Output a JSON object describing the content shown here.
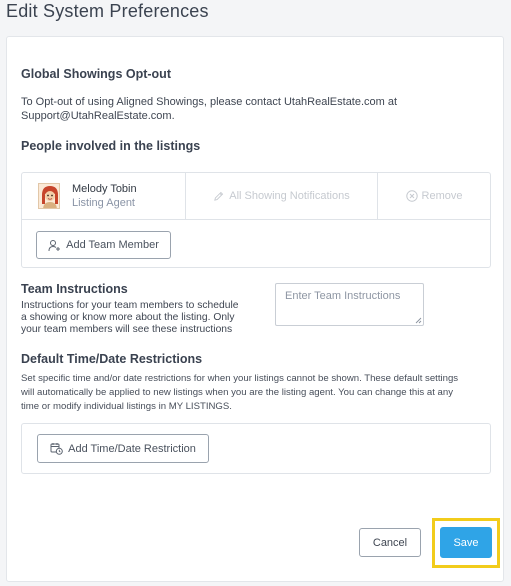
{
  "page": {
    "title": "Edit System Preferences"
  },
  "optout": {
    "heading": "Global Showings Opt-out",
    "line1": "To Opt-out of using Aligned Showings, please contact UtahRealEstate.com at",
    "line2": "Support@UtahRealEstate.com."
  },
  "people": {
    "heading": "People involved in the listings",
    "person": {
      "name": "Melody Tobin",
      "role": "Listing Agent"
    },
    "notifications_label": "All Showing Notifications",
    "remove_label": "Remove",
    "add_member_label": "Add Team Member"
  },
  "team_instructions": {
    "heading": "Team Instructions",
    "line1": "Instructions for your team members to schedule",
    "line2": "a showing or know more about the listing. Only",
    "line3": "your team members will see these instructions",
    "placeholder": "Enter Team Instructions"
  },
  "restrictions": {
    "heading": "Default Time/Date Restrictions",
    "line1": "Set specific time and/or date restrictions for when your listings cannot be shown. These default settings",
    "line2": "will automatically be applied to new listings when you are the listing agent. You can change this at any",
    "line3": "time or modify individual listings in MY LISTINGS.",
    "add_label": "Add Time/Date Restriction"
  },
  "footer": {
    "cancel_label": "Cancel",
    "save_label": "Save"
  },
  "colors": {
    "accent": "#2fa4e7",
    "highlight": "#f2cc1b"
  },
  "icons": [
    "pencil-icon",
    "x-circle-icon",
    "add-user-icon",
    "calendar-clock-icon",
    "resize-grip-icon",
    "avatar"
  ]
}
